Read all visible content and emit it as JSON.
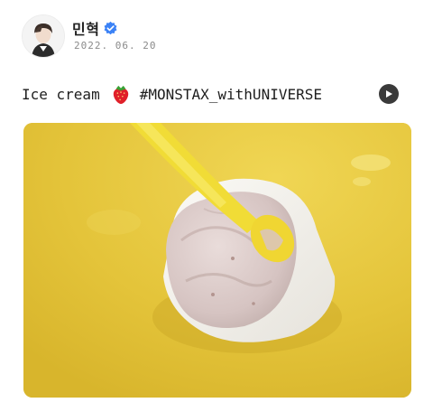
{
  "post": {
    "author": "민혁",
    "date": "2022. 06. 20",
    "text_word": "Ice cream",
    "emoji_name": "strawberry-emoji",
    "hashtag": "#MONSTAX_withUNIVERSE"
  },
  "colors": {
    "verified": "#3b82f6",
    "table_yellow": "#e8c83a",
    "spoon": "#f2de3a",
    "cup": "#f6f4ef",
    "ice_cream": "#d9c9c7"
  },
  "icons": {
    "avatar": "profile-avatar",
    "verified": "verified-badge-icon",
    "play": "play-icon"
  }
}
